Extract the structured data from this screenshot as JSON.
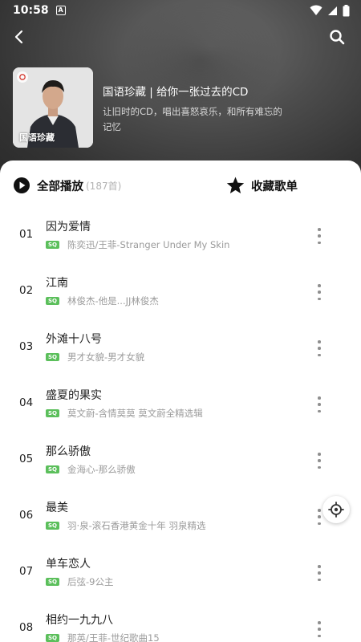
{
  "status_bar": {
    "time": "10:58",
    "notification_icon": "A"
  },
  "nav": {
    "back_icon": "back-arrow-icon",
    "search_icon": "search-icon"
  },
  "playlist": {
    "cover_title": "国语珍藏",
    "title": "国语珍藏 | 给你一张过去的CD",
    "description": "让旧时的CD，唱出喜怒哀乐，和所有难忘的记忆"
  },
  "actions": {
    "play_all_label": "全部播放",
    "play_all_count": "(187首)",
    "collect_label": "收藏歌单"
  },
  "badge_text": "SQ",
  "colors": {
    "badge_green": "#5bbf5b",
    "header_dark": "#333333"
  },
  "songs": [
    {
      "num": "01",
      "name": "因为爱情",
      "artist": "陈奕迅/王菲-Stranger Under My Skin"
    },
    {
      "num": "02",
      "name": "江南",
      "artist": "林俊杰-他是...JJ林俊杰"
    },
    {
      "num": "03",
      "name": "外滩十八号",
      "artist": "男才女貌-男才女貌"
    },
    {
      "num": "04",
      "name": "盛夏的果实",
      "artist": "莫文蔚-含情莫莫 莫文蔚全精选辑"
    },
    {
      "num": "05",
      "name": "那么骄傲",
      "artist": "金海心-那么骄傲"
    },
    {
      "num": "06",
      "name": "最美",
      "artist": "羽·泉-滚石香港黄金十年 羽泉精选"
    },
    {
      "num": "07",
      "name": "单车恋人",
      "artist": "后弦-9公主"
    },
    {
      "num": "08",
      "name": "相约一九九八",
      "artist": "那英/王菲-世纪歌曲15"
    }
  ]
}
